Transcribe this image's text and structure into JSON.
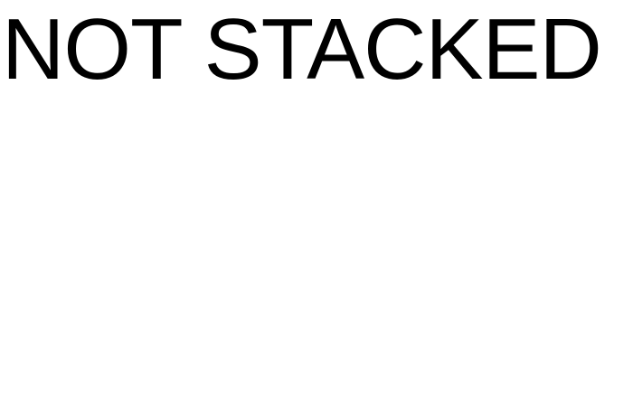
{
  "header": {
    "title": "NOT STACKED"
  },
  "colors": {
    "background": "#ffffff",
    "text": "#000000"
  }
}
